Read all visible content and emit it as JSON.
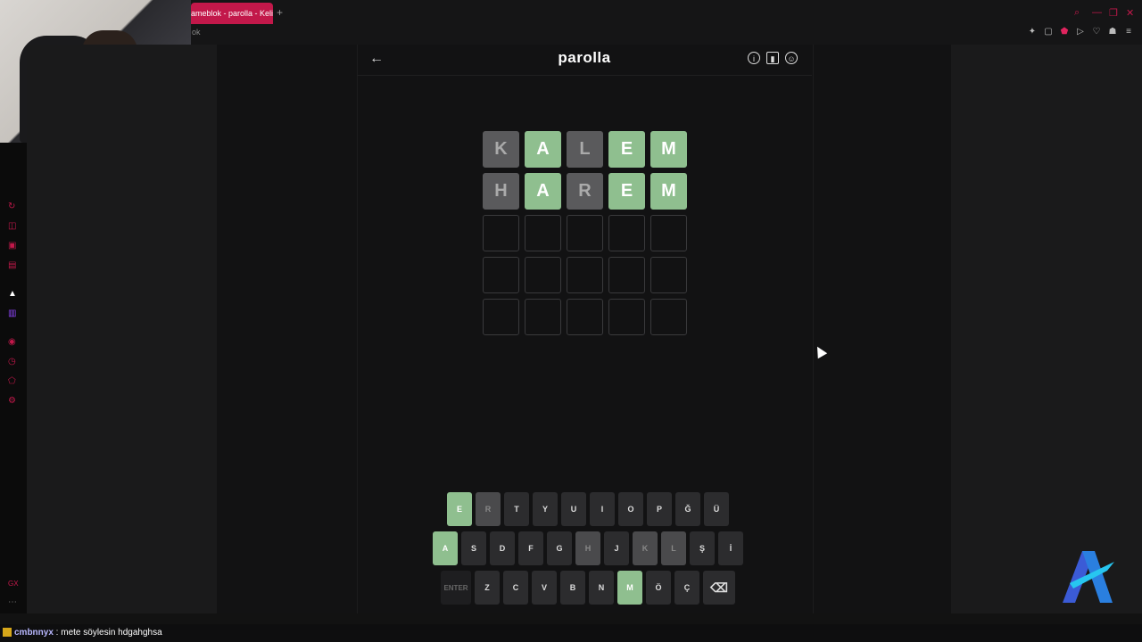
{
  "browser": {
    "tab_title": "ameblok - parolla - Keli",
    "new_tab_label": "+",
    "address_text": "ok"
  },
  "game": {
    "title": "parolla",
    "back_icon": "arrow-left-icon",
    "header_icons": [
      "info-icon",
      "stats-icon",
      "account-icon"
    ],
    "board": [
      [
        {
          "l": "K",
          "s": "absent"
        },
        {
          "l": "A",
          "s": "correct"
        },
        {
          "l": "L",
          "s": "absent"
        },
        {
          "l": "E",
          "s": "correct"
        },
        {
          "l": "M",
          "s": "correct"
        }
      ],
      [
        {
          "l": "H",
          "s": "absent"
        },
        {
          "l": "A",
          "s": "correct"
        },
        {
          "l": "R",
          "s": "absent"
        },
        {
          "l": "E",
          "s": "correct"
        },
        {
          "l": "M",
          "s": "correct"
        }
      ],
      [
        {
          "l": "",
          "s": "empty"
        },
        {
          "l": "",
          "s": "empty"
        },
        {
          "l": "",
          "s": "empty"
        },
        {
          "l": "",
          "s": "empty"
        },
        {
          "l": "",
          "s": "empty"
        }
      ],
      [
        {
          "l": "",
          "s": "empty"
        },
        {
          "l": "",
          "s": "empty"
        },
        {
          "l": "",
          "s": "empty"
        },
        {
          "l": "",
          "s": "empty"
        },
        {
          "l": "",
          "s": "empty"
        }
      ],
      [
        {
          "l": "",
          "s": "empty"
        },
        {
          "l": "",
          "s": "empty"
        },
        {
          "l": "",
          "s": "empty"
        },
        {
          "l": "",
          "s": "empty"
        },
        {
          "l": "",
          "s": "empty"
        }
      ]
    ],
    "keyboard": [
      [
        {
          "k": "E",
          "s": "correct"
        },
        {
          "k": "R",
          "s": "absent"
        },
        {
          "k": "T"
        },
        {
          "k": "Y"
        },
        {
          "k": "U"
        },
        {
          "k": "I"
        },
        {
          "k": "O"
        },
        {
          "k": "P"
        },
        {
          "k": "Ğ"
        },
        {
          "k": "Ü"
        }
      ],
      [
        {
          "k": "A",
          "s": "correct"
        },
        {
          "k": "S"
        },
        {
          "k": "D"
        },
        {
          "k": "F"
        },
        {
          "k": "G"
        },
        {
          "k": "H",
          "s": "absent"
        },
        {
          "k": "J"
        },
        {
          "k": "K",
          "s": "absent"
        },
        {
          "k": "L",
          "s": "absent"
        },
        {
          "k": "Ş"
        },
        {
          "k": "İ"
        }
      ],
      [
        {
          "k": "ENTER",
          "s": "wide"
        },
        {
          "k": "Z"
        },
        {
          "k": "C"
        },
        {
          "k": "V"
        },
        {
          "k": "B"
        },
        {
          "k": "N"
        },
        {
          "k": "M",
          "s": "correct"
        },
        {
          "k": "Ö"
        },
        {
          "k": "Ç"
        },
        {
          "k": "⌫",
          "s": "back"
        }
      ]
    ]
  },
  "chat": {
    "user": "cmbnnyx",
    "message": " : mete söylesin hdgahghsa"
  },
  "colors": {
    "correct": "#8fbf8f",
    "absent": "#5a5a5c",
    "accent": "#c2184a"
  }
}
